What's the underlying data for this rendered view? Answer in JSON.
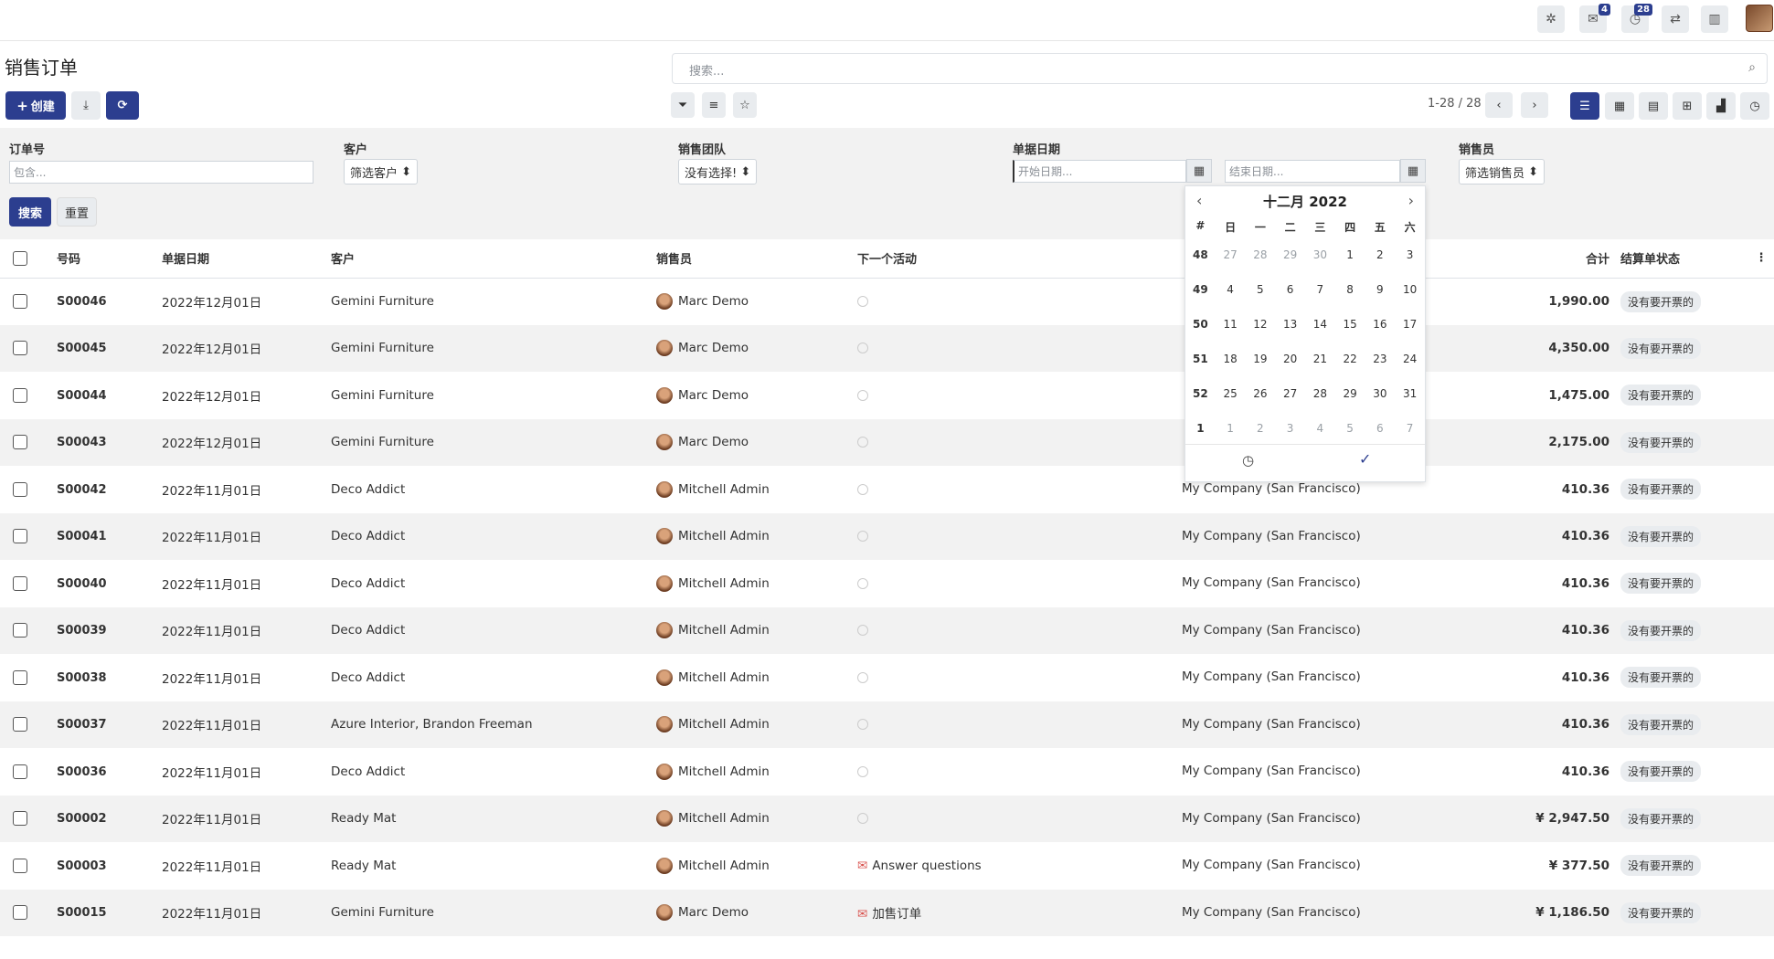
{
  "topbar": {
    "chat_count": "4",
    "activity_count": "28"
  },
  "page": {
    "title": "销售订单",
    "create_label": "创建"
  },
  "search": {
    "placeholder": "搜索..."
  },
  "pager": {
    "text": "1-28 / 28"
  },
  "filters": {
    "order_no": {
      "label": "订单号",
      "placeholder": "包含..."
    },
    "customer": {
      "label": "客户",
      "select": "筛选客户"
    },
    "team": {
      "label": "销售团队",
      "select": "没有选择!"
    },
    "date": {
      "label": "单据日期",
      "start_placeholder": "开始日期...",
      "end_placeholder": "结束日期..."
    },
    "salesperson": {
      "label": "销售员",
      "select": "筛选销售员"
    },
    "search_btn": "搜索",
    "reset_btn": "重置"
  },
  "table": {
    "headers": {
      "number": "号码",
      "date": "单据日期",
      "customer": "客户",
      "salesperson": "销售员",
      "activity": "下一个活动",
      "total": "合计",
      "invoice_status": "结算单状态"
    },
    "rows": [
      {
        "number": "S00046",
        "date": "2022年12月01日",
        "customer": "Gemini Furniture",
        "salesperson": "Marc Demo",
        "activity": "",
        "company": "",
        "total": "1,990.00",
        "status": "没有要开票的"
      },
      {
        "number": "S00045",
        "date": "2022年12月01日",
        "customer": "Gemini Furniture",
        "salesperson": "Marc Demo",
        "activity": "",
        "company": "",
        "total": "4,350.00",
        "status": "没有要开票的"
      },
      {
        "number": "S00044",
        "date": "2022年12月01日",
        "customer": "Gemini Furniture",
        "salesperson": "Marc Demo",
        "activity": "",
        "company": "",
        "total": "1,475.00",
        "status": "没有要开票的"
      },
      {
        "number": "S00043",
        "date": "2022年12月01日",
        "customer": "Gemini Furniture",
        "salesperson": "Marc Demo",
        "activity": "",
        "company": "",
        "total": "2,175.00",
        "status": "没有要开票的"
      },
      {
        "number": "S00042",
        "date": "2022年11月01日",
        "customer": "Deco Addict",
        "salesperson": "Mitchell Admin",
        "activity": "",
        "company": "My Company (San Francisco)",
        "total": "410.36",
        "status": "没有要开票的"
      },
      {
        "number": "S00041",
        "date": "2022年11月01日",
        "customer": "Deco Addict",
        "salesperson": "Mitchell Admin",
        "activity": "",
        "company": "My Company (San Francisco)",
        "total": "410.36",
        "status": "没有要开票的"
      },
      {
        "number": "S00040",
        "date": "2022年11月01日",
        "customer": "Deco Addict",
        "salesperson": "Mitchell Admin",
        "activity": "",
        "company": "My Company (San Francisco)",
        "total": "410.36",
        "status": "没有要开票的"
      },
      {
        "number": "S00039",
        "date": "2022年11月01日",
        "customer": "Deco Addict",
        "salesperson": "Mitchell Admin",
        "activity": "",
        "company": "My Company (San Francisco)",
        "total": "410.36",
        "status": "没有要开票的"
      },
      {
        "number": "S00038",
        "date": "2022年11月01日",
        "customer": "Deco Addict",
        "salesperson": "Mitchell Admin",
        "activity": "",
        "company": "My Company (San Francisco)",
        "total": "410.36",
        "status": "没有要开票的"
      },
      {
        "number": "S00037",
        "date": "2022年11月01日",
        "customer": "Azure Interior, Brandon Freeman",
        "salesperson": "Mitchell Admin",
        "activity": "",
        "company": "My Company (San Francisco)",
        "total": "410.36",
        "status": "没有要开票的"
      },
      {
        "number": "S00036",
        "date": "2022年11月01日",
        "customer": "Deco Addict",
        "salesperson": "Mitchell Admin",
        "activity": "",
        "company": "My Company (San Francisco)",
        "total": "410.36",
        "status": "没有要开票的"
      },
      {
        "number": "S00002",
        "date": "2022年11月01日",
        "customer": "Ready Mat",
        "salesperson": "Mitchell Admin",
        "activity": "",
        "company": "My Company (San Francisco)",
        "total": "¥ 2,947.50",
        "status": "没有要开票的"
      },
      {
        "number": "S00003",
        "date": "2022年11月01日",
        "customer": "Ready Mat",
        "salesperson": "Mitchell Admin",
        "activity": "Answer questions",
        "company": "My Company (San Francisco)",
        "total": "¥ 377.50",
        "status": "没有要开票的"
      },
      {
        "number": "S00015",
        "date": "2022年11月01日",
        "customer": "Gemini Furniture",
        "salesperson": "Marc Demo",
        "activity": "加售订单",
        "company": "My Company (San Francisco)",
        "total": "¥ 1,186.50",
        "status": "没有要开票的"
      }
    ]
  },
  "calendar": {
    "month_label": "十二月 2022",
    "dow": [
      "#",
      "日",
      "一",
      "二",
      "三",
      "四",
      "五",
      "六"
    ],
    "weeks": [
      [
        "48",
        "27",
        "28",
        "29",
        "30",
        "1",
        "2",
        "3"
      ],
      [
        "49",
        "4",
        "5",
        "6",
        "7",
        "8",
        "9",
        "10"
      ],
      [
        "50",
        "11",
        "12",
        "13",
        "14",
        "15",
        "16",
        "17"
      ],
      [
        "51",
        "18",
        "19",
        "20",
        "21",
        "22",
        "23",
        "24"
      ],
      [
        "52",
        "25",
        "26",
        "27",
        "28",
        "29",
        "30",
        "31"
      ],
      [
        "1",
        "1",
        "2",
        "3",
        "4",
        "5",
        "6",
        "7"
      ]
    ],
    "muted": [
      [
        1,
        2,
        3,
        4
      ],
      [],
      [],
      [],
      [],
      [
        1,
        2,
        3,
        4,
        5,
        6,
        7
      ]
    ]
  }
}
